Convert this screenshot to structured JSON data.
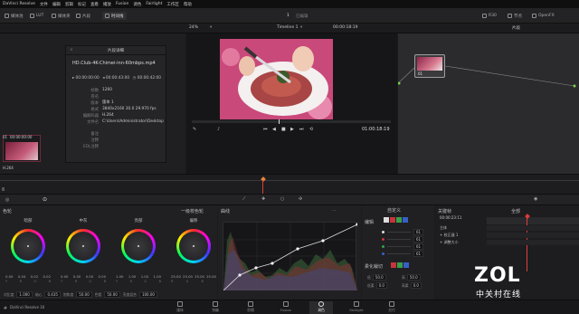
{
  "app": {
    "title": "DaVinci Resolve",
    "menu": [
      "文件",
      "编辑",
      "剪辑",
      "标记",
      "查看",
      "播放",
      "Fusion",
      "调色",
      "Fairlight",
      "工作区",
      "帮助"
    ]
  },
  "toolbar": {
    "left": [
      "媒体池",
      "LUT",
      "媒体夹",
      "片段"
    ],
    "active_tab": "时间线",
    "project_index": "1",
    "project_name": "已编辑",
    "right": [
      "R30",
      "节点",
      "OpenFX",
      "Lightbox"
    ],
    "right_active": "特效库"
  },
  "viewer_bar": {
    "zoom": "24%",
    "timeline_name": "Timeline 1",
    "timecode": "00:00:18:19",
    "clip_label": "片段"
  },
  "clip_info": {
    "header": "片段详细",
    "filename": "HD.Club-4K-Chimei-inn-60mbps.mp4",
    "tc_start": "00:00:00:00",
    "tc_end": "00:00:43:00",
    "tc_dur": "00:00:42:00",
    "fields": [
      {
        "k": "帧数",
        "v": "1260"
      },
      {
        "k": "卷名",
        "v": ""
      },
      {
        "k": "版本",
        "v": "版本 1"
      },
      {
        "k": "格式",
        "v": "3840x2160 30.0 29.970 fps"
      },
      {
        "k": "编解码器",
        "v": "H.264"
      },
      {
        "k": "文件名",
        "v": "C:\\Users\\Administrator\\Desktop"
      },
      {
        "k": "备注",
        "v": ""
      },
      {
        "k": "注释",
        "v": ""
      },
      {
        "k": "EDL注释",
        "v": ""
      }
    ],
    "clip_tc": "00:00:00:00",
    "clip_codec": "H.264",
    "clip_number": "01"
  },
  "viewer": {
    "timecode": "01:00:18:19"
  },
  "node": {
    "label": "01"
  },
  "lower_tabs": {
    "left_title": "色轮",
    "mode": "一级校色轮",
    "curves_title": "曲线",
    "custom": "自定义",
    "keyframes_title": "关键帧",
    "all": "全部"
  },
  "wheels": [
    {
      "name": "暗部",
      "vals": [
        "0.00",
        "0.04",
        "0.02",
        "0.02"
      ],
      "labels": [
        "Y",
        "R",
        "G",
        "B"
      ]
    },
    {
      "name": "中灰",
      "vals": [
        "0.00",
        "0.00",
        "0.00",
        "0.00"
      ],
      "labels": [
        "Y",
        "R",
        "G",
        "B"
      ]
    },
    {
      "name": "亮部",
      "vals": [
        "1.00",
        "1.00",
        "1.00",
        "1.00"
      ],
      "labels": [
        "Y",
        "R",
        "G",
        "B"
      ]
    },
    {
      "name": "偏移",
      "vals": [
        "25.00",
        "25.00",
        "25.00",
        "25.00"
      ],
      "labels": [
        "R",
        "G",
        "B",
        ""
      ]
    }
  ],
  "wheel_footer": {
    "contrast_label": "对比度",
    "contrast": "1.000",
    "pivot_label": "轴心",
    "pivot": "0.435",
    "sat_label": "饱和度",
    "sat": "50.00",
    "hue_label": "色相",
    "hue": "50.00",
    "lum_label": "亮度混合",
    "lum": "100.00"
  },
  "edit_panel": {
    "title": "编辑",
    "values": [
      "61",
      "61",
      "61",
      "61"
    ],
    "soft_title": "柔化裁切",
    "soft": [
      {
        "k": "低",
        "v": "50.0"
      },
      {
        "k": "高",
        "v": "50.0"
      },
      {
        "k": "低柔",
        "v": "0.0"
      },
      {
        "k": "高柔",
        "v": "0.0"
      }
    ]
  },
  "keyframes": {
    "timecode": "00:00:23:11",
    "rows": [
      "主体",
      "+ 校正器 1",
      "+ 调整大小"
    ]
  },
  "pagebar": {
    "product": "DaVinci Resolve 16",
    "pages": [
      "媒体",
      "快编",
      "剪辑",
      "Fusion",
      "调色",
      "Fairlight",
      "交付"
    ],
    "active": "调色"
  },
  "watermark": {
    "big": "ZOL",
    "small": "中关村在线"
  },
  "colors": {
    "accent_red": "#e23b3b",
    "accent_orange": "#e8863a"
  }
}
